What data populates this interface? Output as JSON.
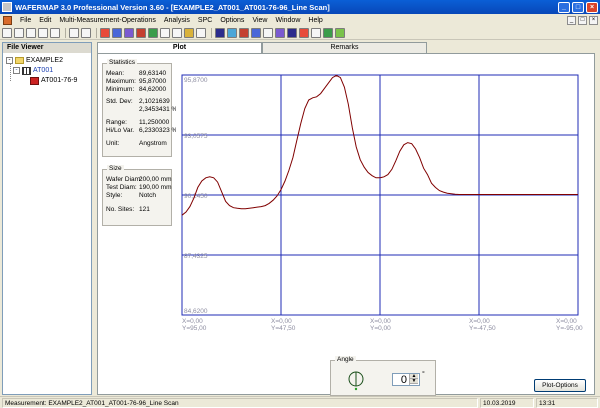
{
  "window": {
    "title": "WAFERMAP 3.0  Professional Version 3.60 - [EXAMPLE2_AT001_AT001-76-96_Line Scan]",
    "controls": [
      "_",
      "□",
      "×"
    ]
  },
  "menu": {
    "items": [
      "File",
      "Edit",
      "Multi-Measurement-Operations",
      "Analysis",
      "SPC",
      "Options",
      "View",
      "Window",
      "Help"
    ],
    "mdi_controls": [
      "_",
      "□",
      "×"
    ]
  },
  "toolbar": {
    "icons": [
      "new-icon",
      "open-icon",
      "save-icon",
      "print-icon",
      "print-preview-icon",
      "wafer-select-icon",
      "multi-wafer-icon",
      "wafer-map-icon",
      "contour-icon",
      "line-scan-icon",
      "histogram-icon",
      "3d-plot-icon",
      "statistics-icon",
      "sigma-icon",
      "trend-icon",
      "chart-icon",
      "color-wafer-icon",
      "globe-icon",
      "target-icon",
      "compare-icon",
      "grid-icon",
      "dimension-icon",
      "text-icon",
      "hd-icon",
      "sigma-view-icon",
      "filter-icon",
      "bar-chart-icon"
    ]
  },
  "file_viewer": {
    "header": "File Viewer",
    "tree": [
      {
        "label": "EXAMPLE2",
        "level": 0,
        "toggle": "-"
      },
      {
        "label": "AT001",
        "level": 1,
        "toggle": "-"
      },
      {
        "label": "AT001-76-9",
        "level": 2,
        "toggle": ""
      }
    ]
  },
  "tabs": [
    {
      "label": "Plot",
      "active": true
    },
    {
      "label": "Remarks",
      "active": false
    }
  ],
  "statistics": {
    "title": "Statistics",
    "mean_label": "Mean:",
    "mean_value": "89,63140",
    "max_label": "Maximum:",
    "max_value": "95,87000",
    "min_label": "Minimum:",
    "min_value": "84,62000",
    "std_label": "Std. Dev:",
    "std_value": "2,1021639",
    "std_pct": "2,3453431 %",
    "range_label": "Range:",
    "range_value": "11,250000",
    "hilo_label": "Hi/Lo Var.",
    "hilo_value": "6,2330323 %",
    "unit_label": "Unit:",
    "unit_value": "Angstrom"
  },
  "size": {
    "title": "Size",
    "wafer_label": "Wafer Diam:",
    "wafer_value": "200,00 mm",
    "test_label": "Test Diam:",
    "test_value": "190,00 mm",
    "style_label": "Style:",
    "style_value": "Notch",
    "sites_label": "No. Sites:",
    "sites_value": "121"
  },
  "chart_data": {
    "type": "line",
    "series": [
      {
        "color": "#800000",
        "x": [
          0,
          1,
          2,
          3,
          4,
          5,
          6,
          7,
          8,
          9,
          10,
          11,
          12,
          13,
          14,
          15,
          16,
          17,
          18,
          19,
          20,
          21,
          22,
          23,
          24,
          25,
          26,
          27,
          28,
          29,
          30,
          31,
          32,
          33,
          34,
          35,
          36,
          37,
          38,
          39,
          40,
          41,
          42,
          43,
          44,
          45,
          46,
          47,
          48,
          49,
          50,
          51,
          52,
          53,
          54,
          55,
          56,
          57,
          58,
          59,
          60,
          61,
          62,
          63,
          64,
          65,
          66,
          67,
          68,
          69,
          70,
          71,
          72,
          73,
          74,
          75,
          76,
          77,
          78,
          79,
          80,
          81,
          82,
          83,
          84,
          85,
          86,
          87,
          88,
          89,
          90,
          91,
          92,
          93,
          94,
          95,
          96,
          97,
          98,
          99,
          100
        ],
        "values": [
          89.3,
          89.45,
          89.7,
          90.1,
          90.6,
          90.9,
          91.05,
          91.1,
          91.05,
          90.85,
          90.4,
          89.95,
          89.75,
          89.65,
          89.62,
          89.6,
          89.6,
          89.62,
          89.65,
          89.68,
          89.7,
          89.75,
          89.85,
          90.0,
          90.2,
          90.5,
          90.9,
          91.4,
          92.0,
          92.8,
          93.6,
          94.3,
          94.7,
          94.8,
          94.85,
          95.0,
          95.25,
          95.5,
          95.75,
          95.85,
          95.75,
          95.3,
          94.5,
          93.4,
          92.5,
          91.9,
          91.55,
          91.3,
          91.15,
          91.05,
          91.05,
          91.1,
          91.2,
          91.45,
          91.85,
          92.3,
          92.6,
          92.7,
          92.65,
          92.4,
          92.0,
          91.5,
          91.2,
          90.8,
          90.6,
          90.45,
          90.38,
          90.33,
          90.3,
          90.28,
          90.27,
          90.27,
          90.27,
          90.27,
          90.27,
          90.27,
          90.27,
          90.27,
          90.27,
          90.27,
          90.27,
          90.27,
          90.27,
          90.27,
          90.27,
          90.27,
          90.27,
          90.27,
          90.27,
          90.27,
          90.27,
          90.27,
          90.27,
          90.27,
          90.27,
          90.27,
          90.27,
          90.27,
          90.27,
          90.27,
          90.27
        ]
      }
    ],
    "ylim": [
      84.62,
      95.87
    ],
    "yticks": [
      "95,8700",
      "93,0575",
      "90,2450",
      "87,4325",
      "84,6200"
    ],
    "xticks": [
      {
        "x": "X=0,00",
        "y": "Y=95,00"
      },
      {
        "x": "X=0,00",
        "y": "Y=47,50"
      },
      {
        "x": "X=0,00",
        "y": "Y=0,00"
      },
      {
        "x": "X=0,00",
        "y": "Y=-47,50"
      },
      {
        "x": "X=0,00",
        "y": "Y=-95,00"
      }
    ],
    "grid": true,
    "line_color": "#800000",
    "grid_color": "#1f2bb5",
    "label_color": "#8c8ca0"
  },
  "angle": {
    "title": "Angle",
    "value": "0",
    "unit": "°"
  },
  "plot_options_label": "Plot-Options",
  "statusbar": {
    "measurement": "Measurement: EXAMPLE2_AT001_AT001-76-96_Line Scan",
    "date": "10.03.2019",
    "time": "13:31"
  }
}
